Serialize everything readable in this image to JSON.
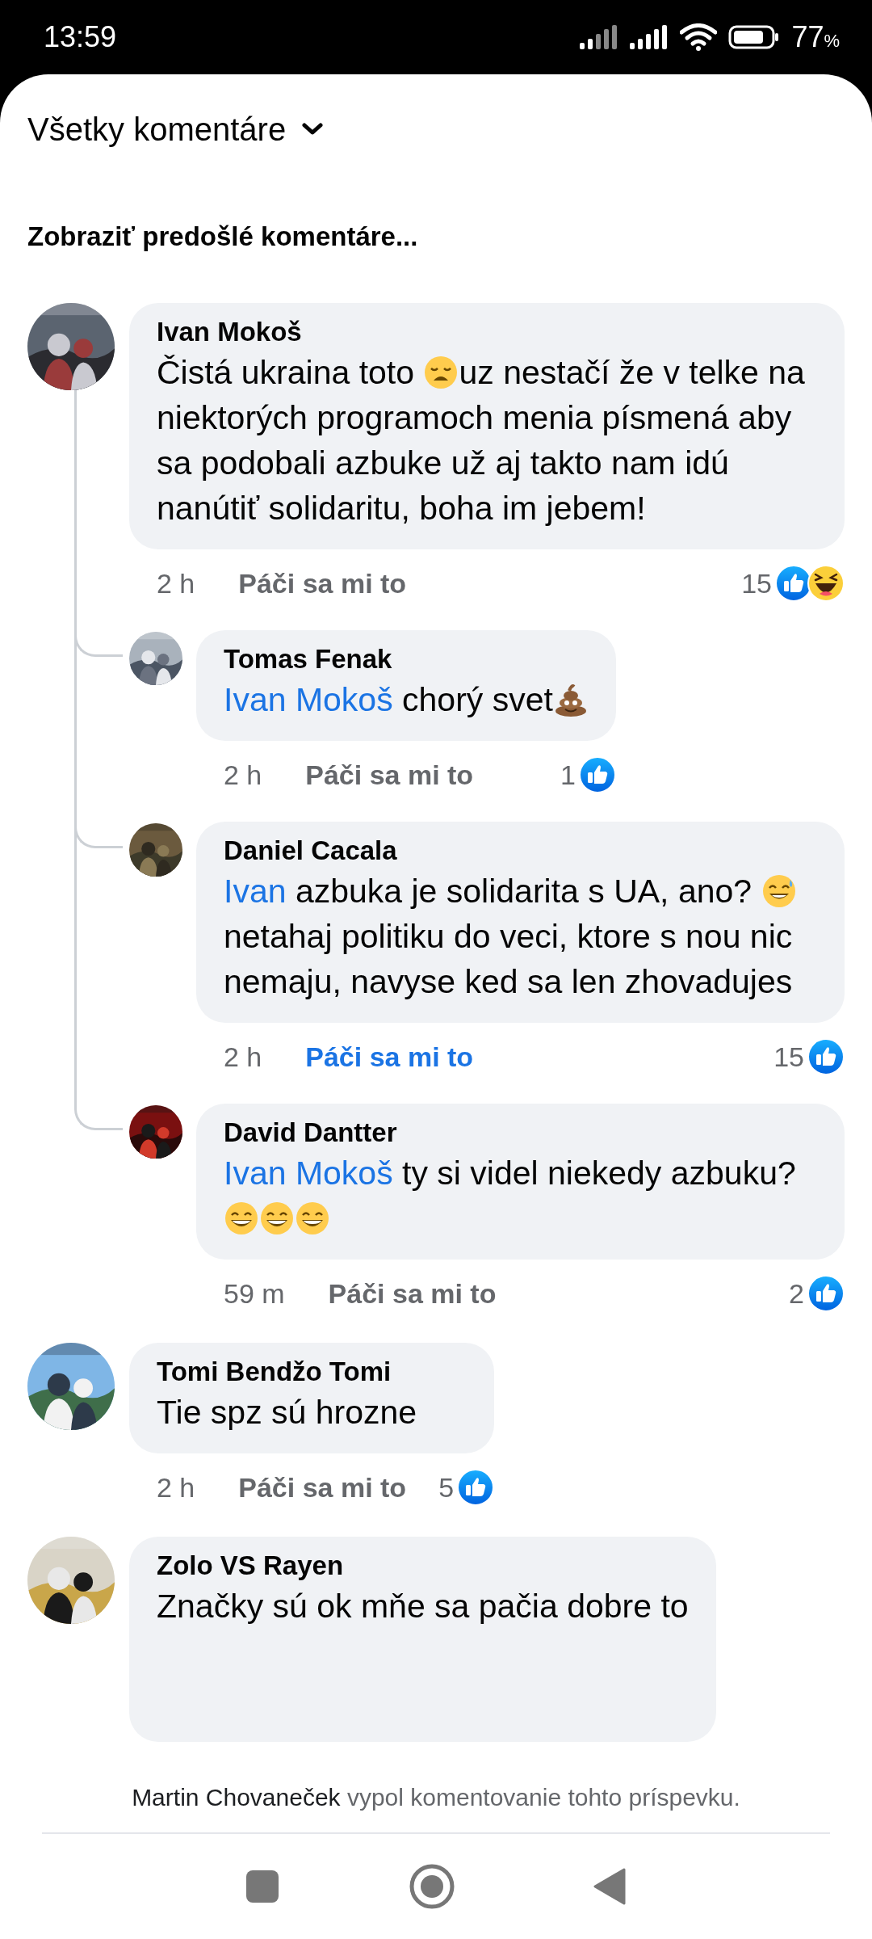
{
  "status_bar": {
    "time": "13:59",
    "battery_percent": "77",
    "percent_sign": "%"
  },
  "header": {
    "title": "Všetky komentáre"
  },
  "previous_link": "Zobraziť predošlé komentáre...",
  "comments": [
    {
      "author": "Ivan Mokoš",
      "segments": [
        {
          "kind": "text",
          "text": "Čistá ukraina toto "
        },
        {
          "kind": "weary"
        },
        {
          "kind": "text",
          "text": "uz nestačí že v telke na niektorých programoch menia písmená aby sa podobali azbuke už aj takto nam idú nanútiť solidaritu, boha im jebem!"
        }
      ],
      "time": "2 h",
      "like_label": "Páči sa mi to",
      "liked": false,
      "reaction_count": "15",
      "reactions": [
        {
          "kind": "like"
        },
        {
          "kind": "haha"
        }
      ],
      "replies": [
        {
          "author": "Tomas Fenak",
          "segments": [
            {
              "kind": "mention",
              "text": "Ivan Mokoš"
            },
            {
              "kind": "text",
              "text": " chorý svet"
            },
            {
              "kind": "poop"
            }
          ],
          "time": "2 h",
          "like_label": "Páči sa mi to",
          "liked": false,
          "reaction_count": "1",
          "reactions": [
            {
              "kind": "like"
            }
          ]
        },
        {
          "author": "Daniel Cacala",
          "segments": [
            {
              "kind": "mention",
              "text": "Ivan"
            },
            {
              "kind": "text",
              "text": " azbuka je solidarita s UA, ano? "
            },
            {
              "kind": "sweat_smile"
            },
            {
              "kind": "text",
              "text": " netahaj politiku do veci, ktore s nou nic nemaju, navyse ked sa len zhovadujes"
            }
          ],
          "time": "2 h",
          "like_label": "Páči sa mi to",
          "liked": true,
          "reaction_count": "15",
          "reactions": [
            {
              "kind": "like"
            }
          ]
        },
        {
          "author": "David Dantter",
          "segments": [
            {
              "kind": "mention",
              "text": "Ivan Mokoš"
            },
            {
              "kind": "text",
              "text": " ty si videl niekedy azbuku? "
            },
            {
              "kind": "grin"
            },
            {
              "kind": "grin"
            },
            {
              "kind": "grin"
            }
          ],
          "time": "59 m",
          "like_label": "Páči sa mi to",
          "liked": false,
          "reaction_count": "2",
          "reactions": [
            {
              "kind": "like"
            }
          ]
        }
      ]
    },
    {
      "author": "Tomi Bendžo Tomi",
      "segments": [
        {
          "kind": "text",
          "text": "Tie spz sú hrozne"
        }
      ],
      "time": "2 h",
      "like_label": "Páči sa mi to",
      "liked": false,
      "reaction_count": "5",
      "reactions": [
        {
          "kind": "like"
        }
      ]
    },
    {
      "author": "Zolo VS Rayen",
      "segments": [
        {
          "kind": "text",
          "text": "Značky sú ok mňe sa pačia  dobre to"
        }
      ]
    }
  ],
  "footer": {
    "notice": "**Martin Chovaneček** vypol komentovanie tohto príspevku."
  }
}
